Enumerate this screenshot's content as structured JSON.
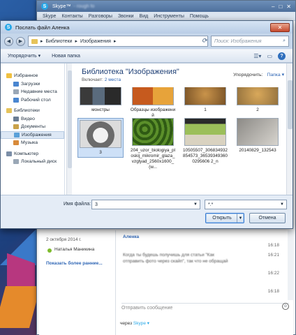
{
  "skype": {
    "title": "Skype™",
    "title_user": "- rough fo",
    "menu": [
      "Skype",
      "Контакты",
      "Разговоры",
      "Звонки",
      "Вид",
      "Инструменты",
      "Помощь"
    ],
    "window_buttons": [
      "–",
      "□",
      "✕"
    ]
  },
  "dialog": {
    "title": "Послать файл Аленка",
    "close": "✕",
    "breadcrumb": [
      "Библиотеки",
      "Изображения"
    ],
    "search_placeholder": "Поиск: Изображения",
    "toolbar": {
      "organize": "Упорядочить ▾",
      "new_folder": "Новая папка"
    },
    "nav": [
      {
        "label": "Избранное",
        "level": 0,
        "color": "#f0c040"
      },
      {
        "label": "Загрузки",
        "level": 1,
        "color": "#4a86d0"
      },
      {
        "label": "Недавние места",
        "level": 1,
        "color": "#9aa7b6"
      },
      {
        "label": "Рабочий стол",
        "level": 1,
        "color": "#4a86d0"
      },
      {
        "label": "Библиотеки",
        "level": 0,
        "color": "#e6c35a"
      },
      {
        "label": "Видео",
        "level": 1,
        "color": "#6b7d93"
      },
      {
        "label": "Документы",
        "level": 1,
        "color": "#c9a24a"
      },
      {
        "label": "Изображения",
        "level": 1,
        "color": "#5aa0d8",
        "selected": true
      },
      {
        "label": "Музыка",
        "level": 1,
        "color": "#d88a3a"
      },
      {
        "label": "Компьютер",
        "level": 0,
        "color": "#7b8ea7"
      },
      {
        "label": "Локальный диск",
        "level": 1,
        "color": "#9aa7b6"
      }
    ],
    "library_title": "Библиотека \"Изображения\"",
    "includes_label": "Включает:",
    "includes_link": "2 места",
    "arrange_label": "Упорядочить:",
    "arrange_value": "Папка ▾",
    "items": [
      {
        "label": "монстры",
        "kind": "folder-dark"
      },
      {
        "label": "Образцы изображений",
        "kind": "folder-orange"
      },
      {
        "label": "1",
        "kind": "lion"
      },
      {
        "label": "2",
        "kind": "lion2"
      },
      {
        "label": "3",
        "kind": "husky",
        "selected": true
      },
      {
        "label": "204_uzor_biologiya_ploskij_mikromir_glaza_vzglyad_2560x1600_(w...",
        "kind": "green"
      },
      {
        "label": "10505507_306834932854573_365393493600295606 2_n",
        "kind": "photo-green"
      },
      {
        "label": "20140829_132543",
        "kind": "photo-grey"
      }
    ],
    "filename_label": "Имя файла:",
    "filename_value": "3",
    "filetype_value": "*.*",
    "open_button": "Открыть",
    "cancel_button": "Отмена"
  },
  "chat": {
    "side_date": "2 октября 2014 г.",
    "side_contact": "Наталья Маникина",
    "show_more": "Показать более ранние...",
    "messages": [
      {
        "name": "Аленка",
        "text": "",
        "time": "16:18"
      },
      {
        "name": "",
        "text": "Когда ты будешь получишь для статьи \"Как",
        "time": "16:21"
      },
      {
        "name": "",
        "text": "отправить фото через скайп\", так что не обращай",
        "time": ""
      },
      {
        "name": "",
        "text": "",
        "time": "16:22"
      },
      {
        "name": "",
        "text": "",
        "time": "16:18"
      }
    ],
    "input_placeholder": "Отправить сообщение",
    "via_label": "через",
    "via_service": "Skype ▾"
  }
}
